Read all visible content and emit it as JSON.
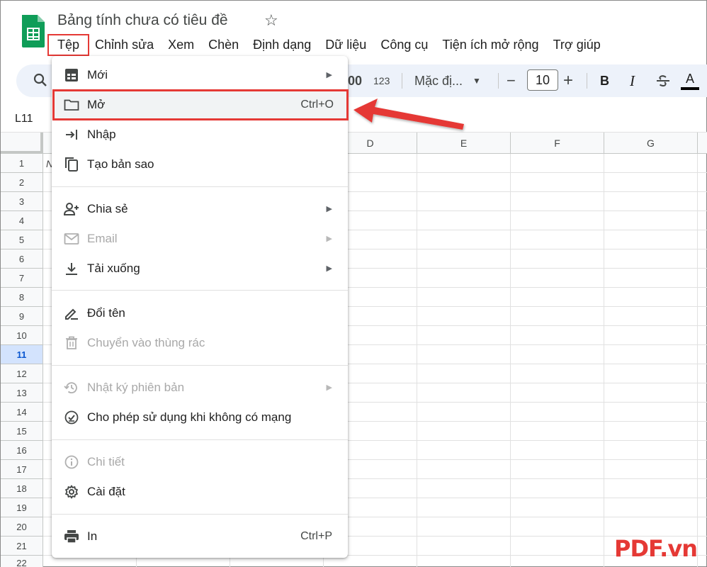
{
  "app": {
    "title": "Bảng tính chưa có tiêu đề",
    "star_icon": "star-icon",
    "logo_icon": "sheets-logo-icon"
  },
  "menubar": {
    "items": [
      "Tệp",
      "Chỉnh sửa",
      "Xem",
      "Chèn",
      "Định dạng",
      "Dữ liệu",
      "Công cụ",
      "Tiện ích mở rộng",
      "Trợ giúp"
    ]
  },
  "toolbar": {
    "format_00": "00",
    "format_123": "123",
    "font_name": "Mặc đị...",
    "font_size": "10",
    "bold": "B",
    "italic": "I",
    "text_color": "A",
    "minus": "−",
    "plus": "+"
  },
  "formula": {
    "name_box": "L11"
  },
  "grid": {
    "columns": [
      "D",
      "E",
      "F",
      "G"
    ],
    "rows": [
      "1",
      "2",
      "3",
      "4",
      "5",
      "6",
      "7",
      "8",
      "9",
      "10",
      "11",
      "12",
      "13",
      "14",
      "15",
      "16",
      "17",
      "18",
      "19",
      "20",
      "21",
      "22"
    ],
    "active_row": "11",
    "cell_peek": "N"
  },
  "file_menu": {
    "items": {
      "new": {
        "label": "Mới",
        "icon": "new-sheet-icon"
      },
      "open": {
        "label": "Mở",
        "shortcut": "Ctrl+O",
        "icon": "folder-icon"
      },
      "import": {
        "label": "Nhập",
        "icon": "import-icon"
      },
      "copy": {
        "label": "Tạo bản sao",
        "icon": "copy-icon"
      },
      "share": {
        "label": "Chia sẻ",
        "icon": "share-person-icon"
      },
      "email": {
        "label": "Email",
        "icon": "email-icon"
      },
      "download": {
        "label": "Tải xuống",
        "icon": "download-icon"
      },
      "rename": {
        "label": "Đổi tên",
        "icon": "rename-icon"
      },
      "trash": {
        "label": "Chuyển vào thùng rác",
        "icon": "trash-icon"
      },
      "history": {
        "label": "Nhật ký phiên bản",
        "icon": "history-icon"
      },
      "offline": {
        "label": "Cho phép sử dụng khi không có mạng",
        "icon": "offline-check-icon"
      },
      "details": {
        "label": "Chi tiết",
        "icon": "info-icon"
      },
      "settings": {
        "label": "Cài đặt",
        "icon": "gear-icon"
      },
      "print": {
        "label": "In",
        "shortcut": "Ctrl+P",
        "icon": "print-icon"
      }
    }
  },
  "watermark": "PDF.vn",
  "colors": {
    "highlight_red": "#e53935",
    "sheets_green": "#0f9d58",
    "toolbar_bg": "#edf2fa",
    "active_row_bg": "#d3e3fd"
  }
}
